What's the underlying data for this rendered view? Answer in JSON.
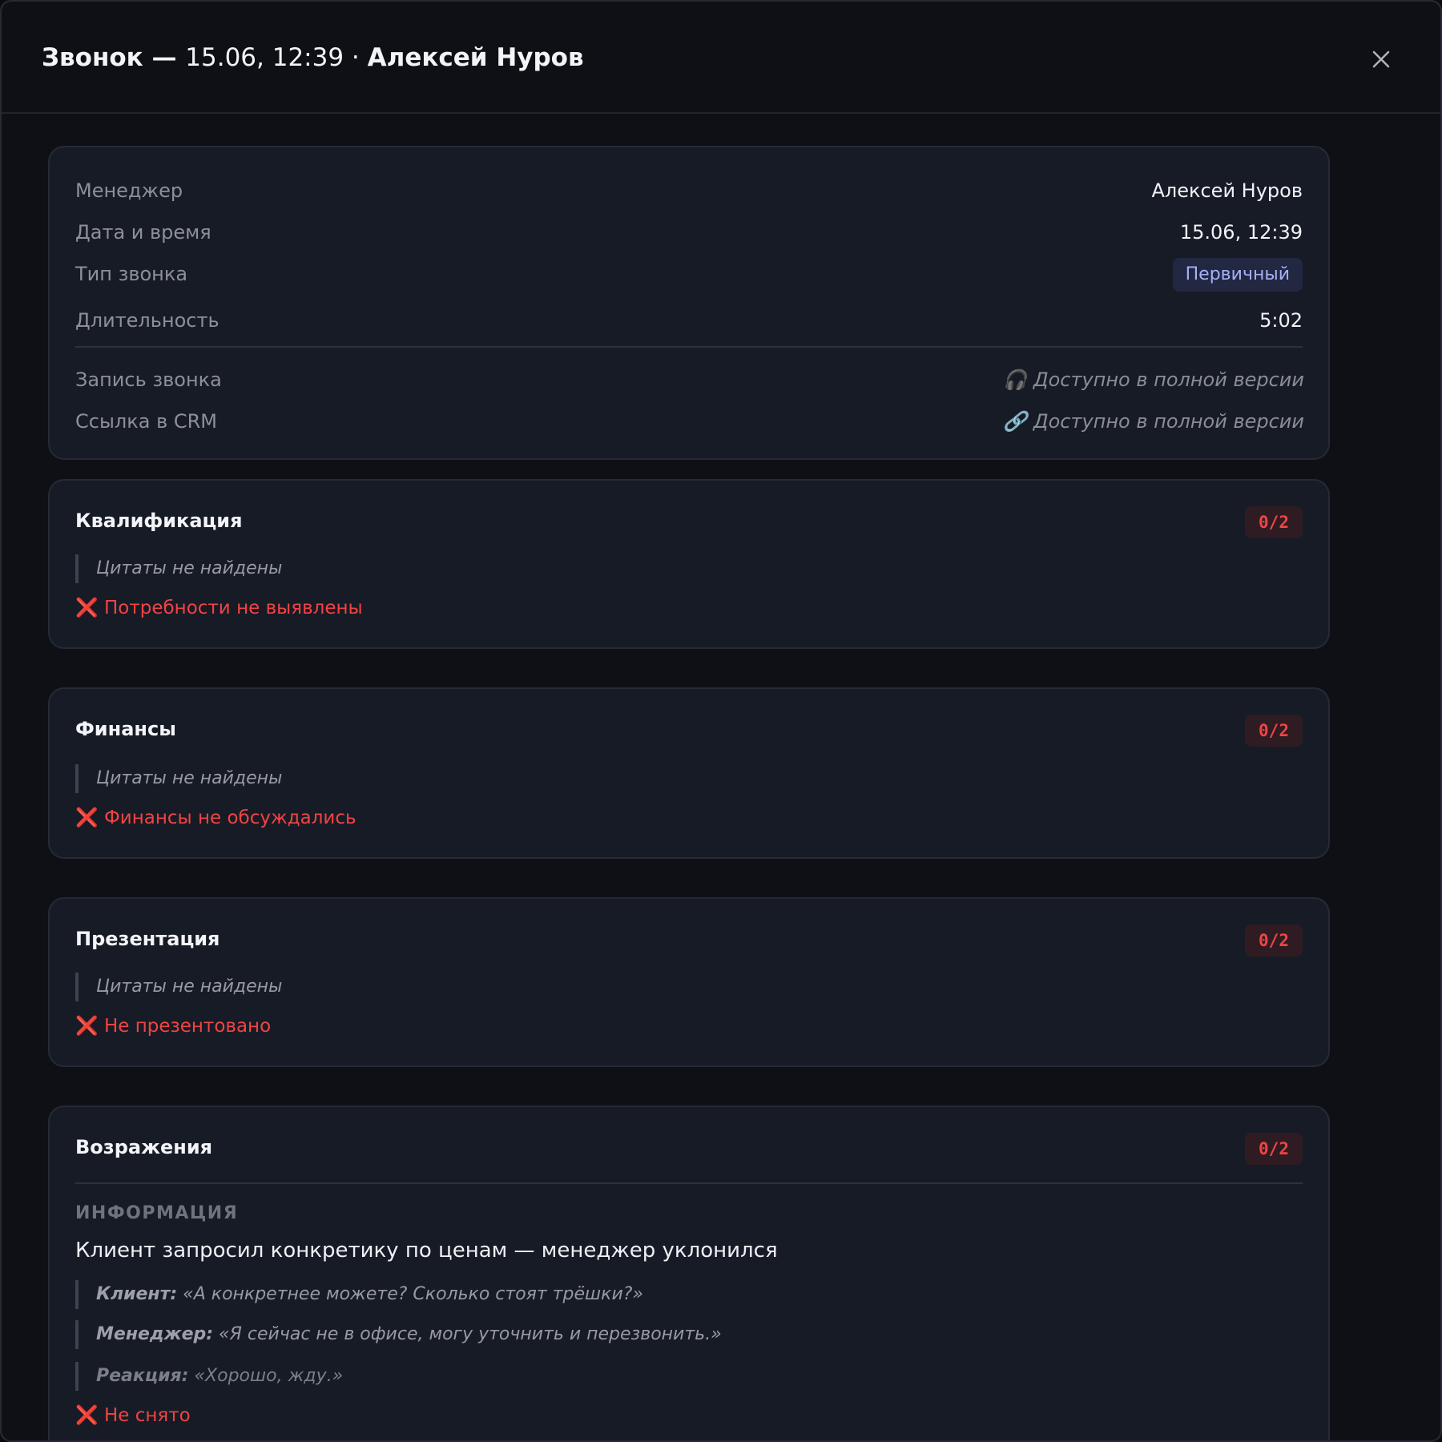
{
  "header": {
    "title_prefix": "Звонок — ",
    "title_datetime": "15.06, 12:39 · ",
    "title_manager": "Алексей Нуров",
    "close_icon": "close-icon"
  },
  "details": {
    "manager_label": "Менеджер",
    "manager_value": "Алексей Нуров",
    "datetime_label": "Дата и время",
    "datetime_value": "15.06, 12:39",
    "type_label": "Тип звонка",
    "type_value": "Первичный",
    "duration_label": "Длительность",
    "duration_value": "5:02",
    "recording_label": "Запись звонка",
    "recording_value": "🎧 Доступно в полной версии",
    "crm_label": "Ссылка в CRM",
    "crm_value": "🔗 Доступно в полной версии"
  },
  "sections": [
    {
      "title": "Квалификация",
      "score": "0/2",
      "quote": "Цитаты не найдены",
      "verdict_icon": "❌",
      "verdict": "Потребности не выявлены"
    },
    {
      "title": "Финансы",
      "score": "0/2",
      "quote": "Цитаты не найдены",
      "verdict_icon": "❌",
      "verdict": "Финансы не обсуждались"
    },
    {
      "title": "Презентация",
      "score": "0/2",
      "quote": "Цитаты не найдены",
      "verdict_icon": "❌",
      "verdict": "Не презентовано"
    },
    {
      "title": "Возражения",
      "score": "0/2",
      "sub_heading": "ИНФОРМАЦИЯ",
      "info": "Клиент запросил конкретику по ценам — менеджер уклонился",
      "quotes": [
        {
          "who": "Клиент:",
          "text": " «А конкретнее можете? Сколько стоят трёшки?»"
        },
        {
          "who": "Менеджер:",
          "text": " «Я сейчас не в офисе, могу уточнить и перезвонить.»"
        },
        {
          "who": "Реакция:",
          "text": " «Хорошо, жду.»"
        }
      ],
      "verdict_icon": "❌",
      "verdict": "Не снято"
    }
  ],
  "colors": {
    "background": "#0e1015",
    "card": "#171b26",
    "fail": "#ef4444",
    "badge_primary": "#a6b0f5"
  }
}
